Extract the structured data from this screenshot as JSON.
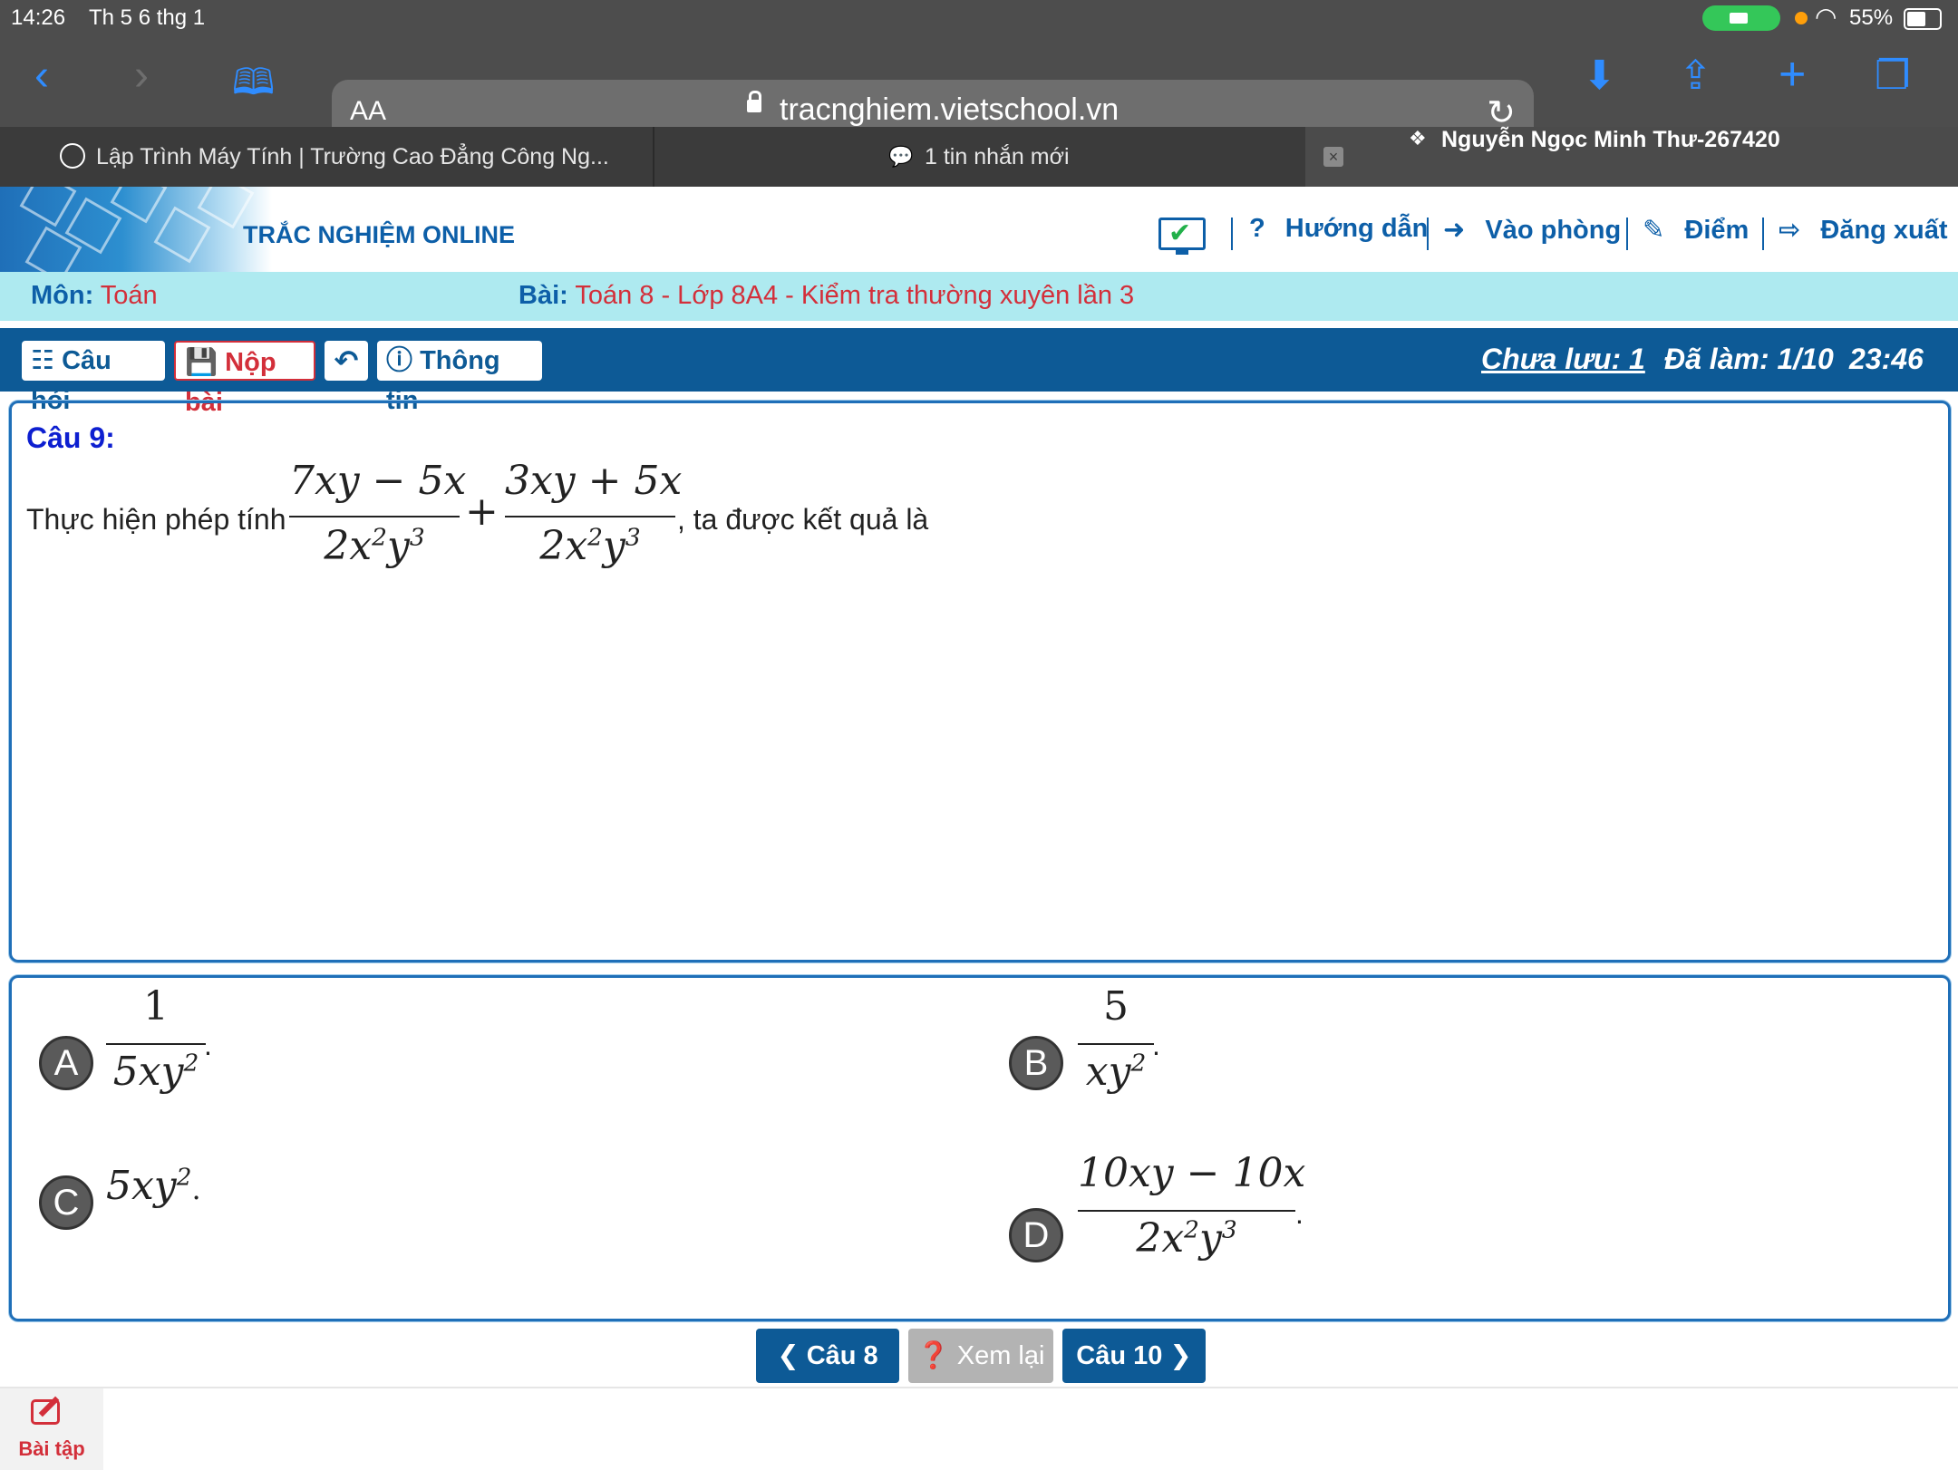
{
  "status_bar": {
    "time": "14:26",
    "date": "Th 5 6 thg 1",
    "battery": "55%"
  },
  "browser": {
    "aa_label": "AA",
    "url": "tracnghiem.vietschool.vn",
    "tabs": [
      {
        "label": "Lập Trình Máy Tính | Trường Cao Đẳng Công Ng..."
      },
      {
        "label": "1 tin nhắn mới"
      },
      {
        "label": "Nguyễn Ngọc Minh Thư-267420"
      }
    ]
  },
  "site": {
    "title": "TRẮC NGHIỆM ONLINE",
    "nav": [
      {
        "icon": "?",
        "label": "Hướng dẫn"
      },
      {
        "icon": "➜",
        "label": "Vào phòng"
      },
      {
        "icon": "✎",
        "label": "Điểm"
      },
      {
        "icon": "⇨",
        "label": "Đăng xuất"
      }
    ]
  },
  "subject": {
    "mon_label": "Môn:",
    "mon_value": "Toán",
    "bai_label": "Bài:",
    "bai_value": "Toán 8 - Lớp 8A4 - Kiểm tra thường xuyên lần 3"
  },
  "actions": {
    "cau_hoi": "Câu hỏi",
    "nop_bai": "Nộp bài",
    "thong_tin": "Thông tin",
    "chua_luu": "Chưa lưu: 1",
    "da_lam": "Đã làm: 1/10",
    "timer": "23:46"
  },
  "question": {
    "title": "Câu 9:",
    "prefix": "Thực hiện phép tính",
    "suffix": ", ta được kết quả là",
    "frac1_num": "7xy − 5x",
    "frac2_num": "3xy + 5x",
    "frac_den_base": "2x",
    "frac_den_exp1": "2",
    "frac_den_y": "y",
    "frac_den_exp2": "3",
    "plus": "+"
  },
  "answers": {
    "A": {
      "letter": "A",
      "num": "1",
      "den_base": "5xy",
      "den_exp": "2"
    },
    "B": {
      "letter": "B",
      "num": "5",
      "den_base": "xy",
      "den_exp": "2"
    },
    "C": {
      "letter": "C",
      "base": "5xy",
      "exp": "2"
    },
    "D": {
      "letter": "D",
      "num": "10xy − 10x",
      "den_base": "2x",
      "den_exp1": "2",
      "den_y": "y",
      "den_exp2": "3"
    },
    "period": "."
  },
  "bottom_nav": {
    "prev": "Câu 8",
    "review": "Xem lại",
    "next": "Câu 10"
  },
  "bottom_tab": {
    "label": "Bài tập"
  },
  "colors": {
    "brand_blue": "#0d5a96",
    "accent_red": "#d32f3a",
    "subject_bg": "#aeeaf0",
    "ios_blue": "#2f8cff"
  }
}
